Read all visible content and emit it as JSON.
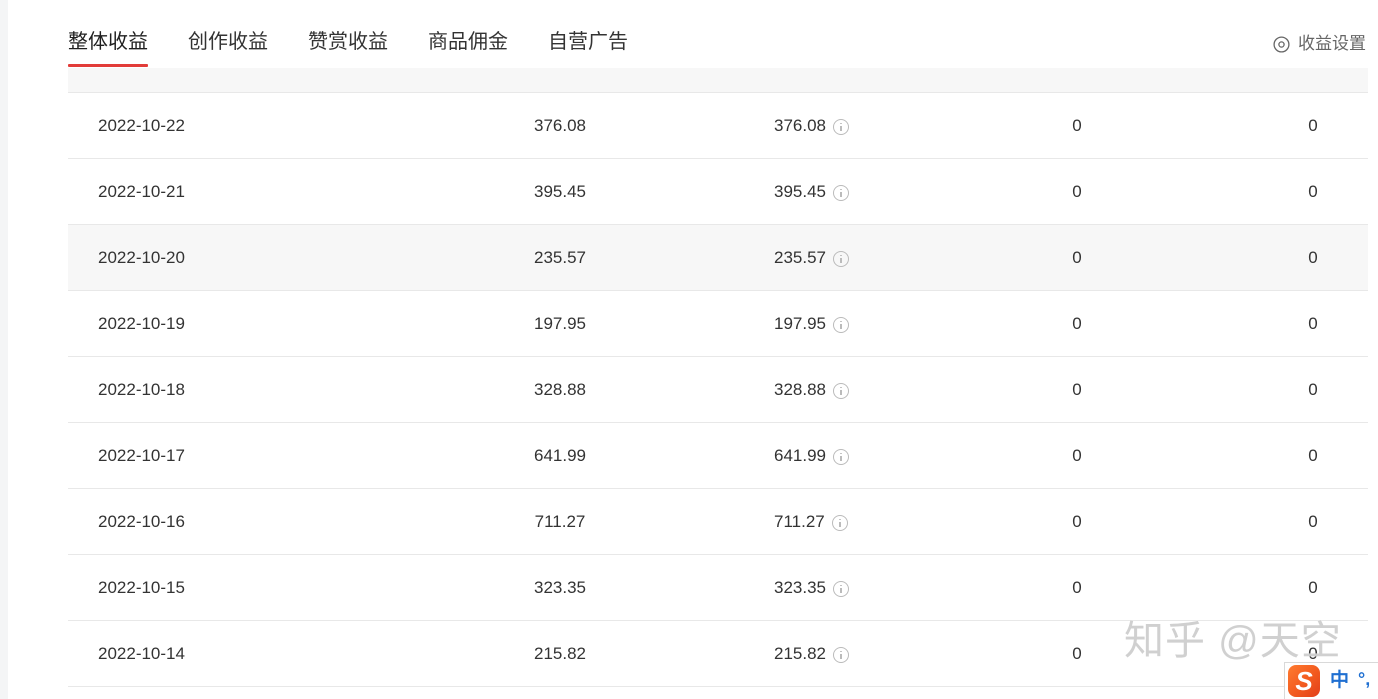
{
  "tabs": [
    {
      "label": "整体收益"
    },
    {
      "label": "创作收益"
    },
    {
      "label": "赞赏收益"
    },
    {
      "label": "商品佣金"
    },
    {
      "label": "自营广告"
    }
  ],
  "settings": {
    "label": "收益设置",
    "icon": "settings-icon"
  },
  "table": {
    "info_icon": "info-icon",
    "rows": [
      {
        "date": "2022-10-22",
        "col2": "376.08",
        "col3": "376.08",
        "col4": "0",
        "col5": "0"
      },
      {
        "date": "2022-10-21",
        "col2": "395.45",
        "col3": "395.45",
        "col4": "0",
        "col5": "0"
      },
      {
        "date": "2022-10-20",
        "col2": "235.57",
        "col3": "235.57",
        "col4": "0",
        "col5": "0"
      },
      {
        "date": "2022-10-19",
        "col2": "197.95",
        "col3": "197.95",
        "col4": "0",
        "col5": "0"
      },
      {
        "date": "2022-10-18",
        "col2": "328.88",
        "col3": "328.88",
        "col4": "0",
        "col5": "0"
      },
      {
        "date": "2022-10-17",
        "col2": "641.99",
        "col3": "641.99",
        "col4": "0",
        "col5": "0"
      },
      {
        "date": "2022-10-16",
        "col2": "711.27",
        "col3": "711.27",
        "col4": "0",
        "col5": "0"
      },
      {
        "date": "2022-10-15",
        "col2": "323.35",
        "col3": "323.35",
        "col4": "0",
        "col5": "0"
      },
      {
        "date": "2022-10-14",
        "col2": "215.82",
        "col3": "215.82",
        "col4": "0",
        "col5": "0"
      }
    ]
  },
  "watermark": "知乎 @天空",
  "ime": {
    "logo": "S",
    "mode": "中",
    "punctuation": "°,"
  },
  "colors": {
    "accent": "#e23c39",
    "text": "#333333",
    "muted": "#666666",
    "info": "#bbbbbb",
    "ime_brand": "#f25a1f",
    "ime_text": "#1f6fd1"
  }
}
